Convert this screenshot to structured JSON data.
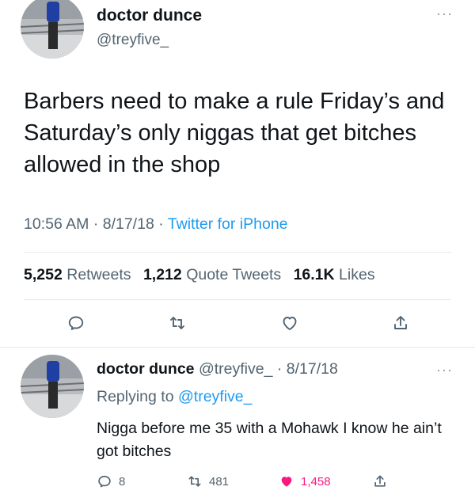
{
  "main_tweet": {
    "author_name": "doctor dunce",
    "author_handle": "@treyfive_",
    "more_label": "···",
    "text": "Barbers need to make a rule Friday’s and Saturday’s only niggas that get bitches allowed in the shop",
    "time": "10:56 AM",
    "date": "8/17/18",
    "source": "Twitter for iPhone",
    "stats": {
      "retweets_count": "5,252",
      "retweets_label": "Retweets",
      "quote_count": "1,212",
      "quote_label": "Quote Tweets",
      "likes_count": "16.1K",
      "likes_label": "Likes"
    },
    "actions": [
      "reply-icon",
      "retweet-icon",
      "like-icon",
      "share-icon"
    ]
  },
  "reply": {
    "author_name": "doctor dunce",
    "author_handle": "@treyfive_",
    "date": "8/17/18",
    "more_label": "···",
    "replying_prefix": "Replying to",
    "replying_to": "@treyfive_",
    "text": "Nigga before me 35 with a Mohawk I know he ain’t got bitches",
    "reply_count": "8",
    "retweet_count": "481",
    "like_count": "1,458",
    "liked": true
  },
  "colors": {
    "text": "#0f1419",
    "secondary": "#536471",
    "accent": "#1d9bf0",
    "like": "#f91880",
    "divider": "#e6e9ec"
  }
}
